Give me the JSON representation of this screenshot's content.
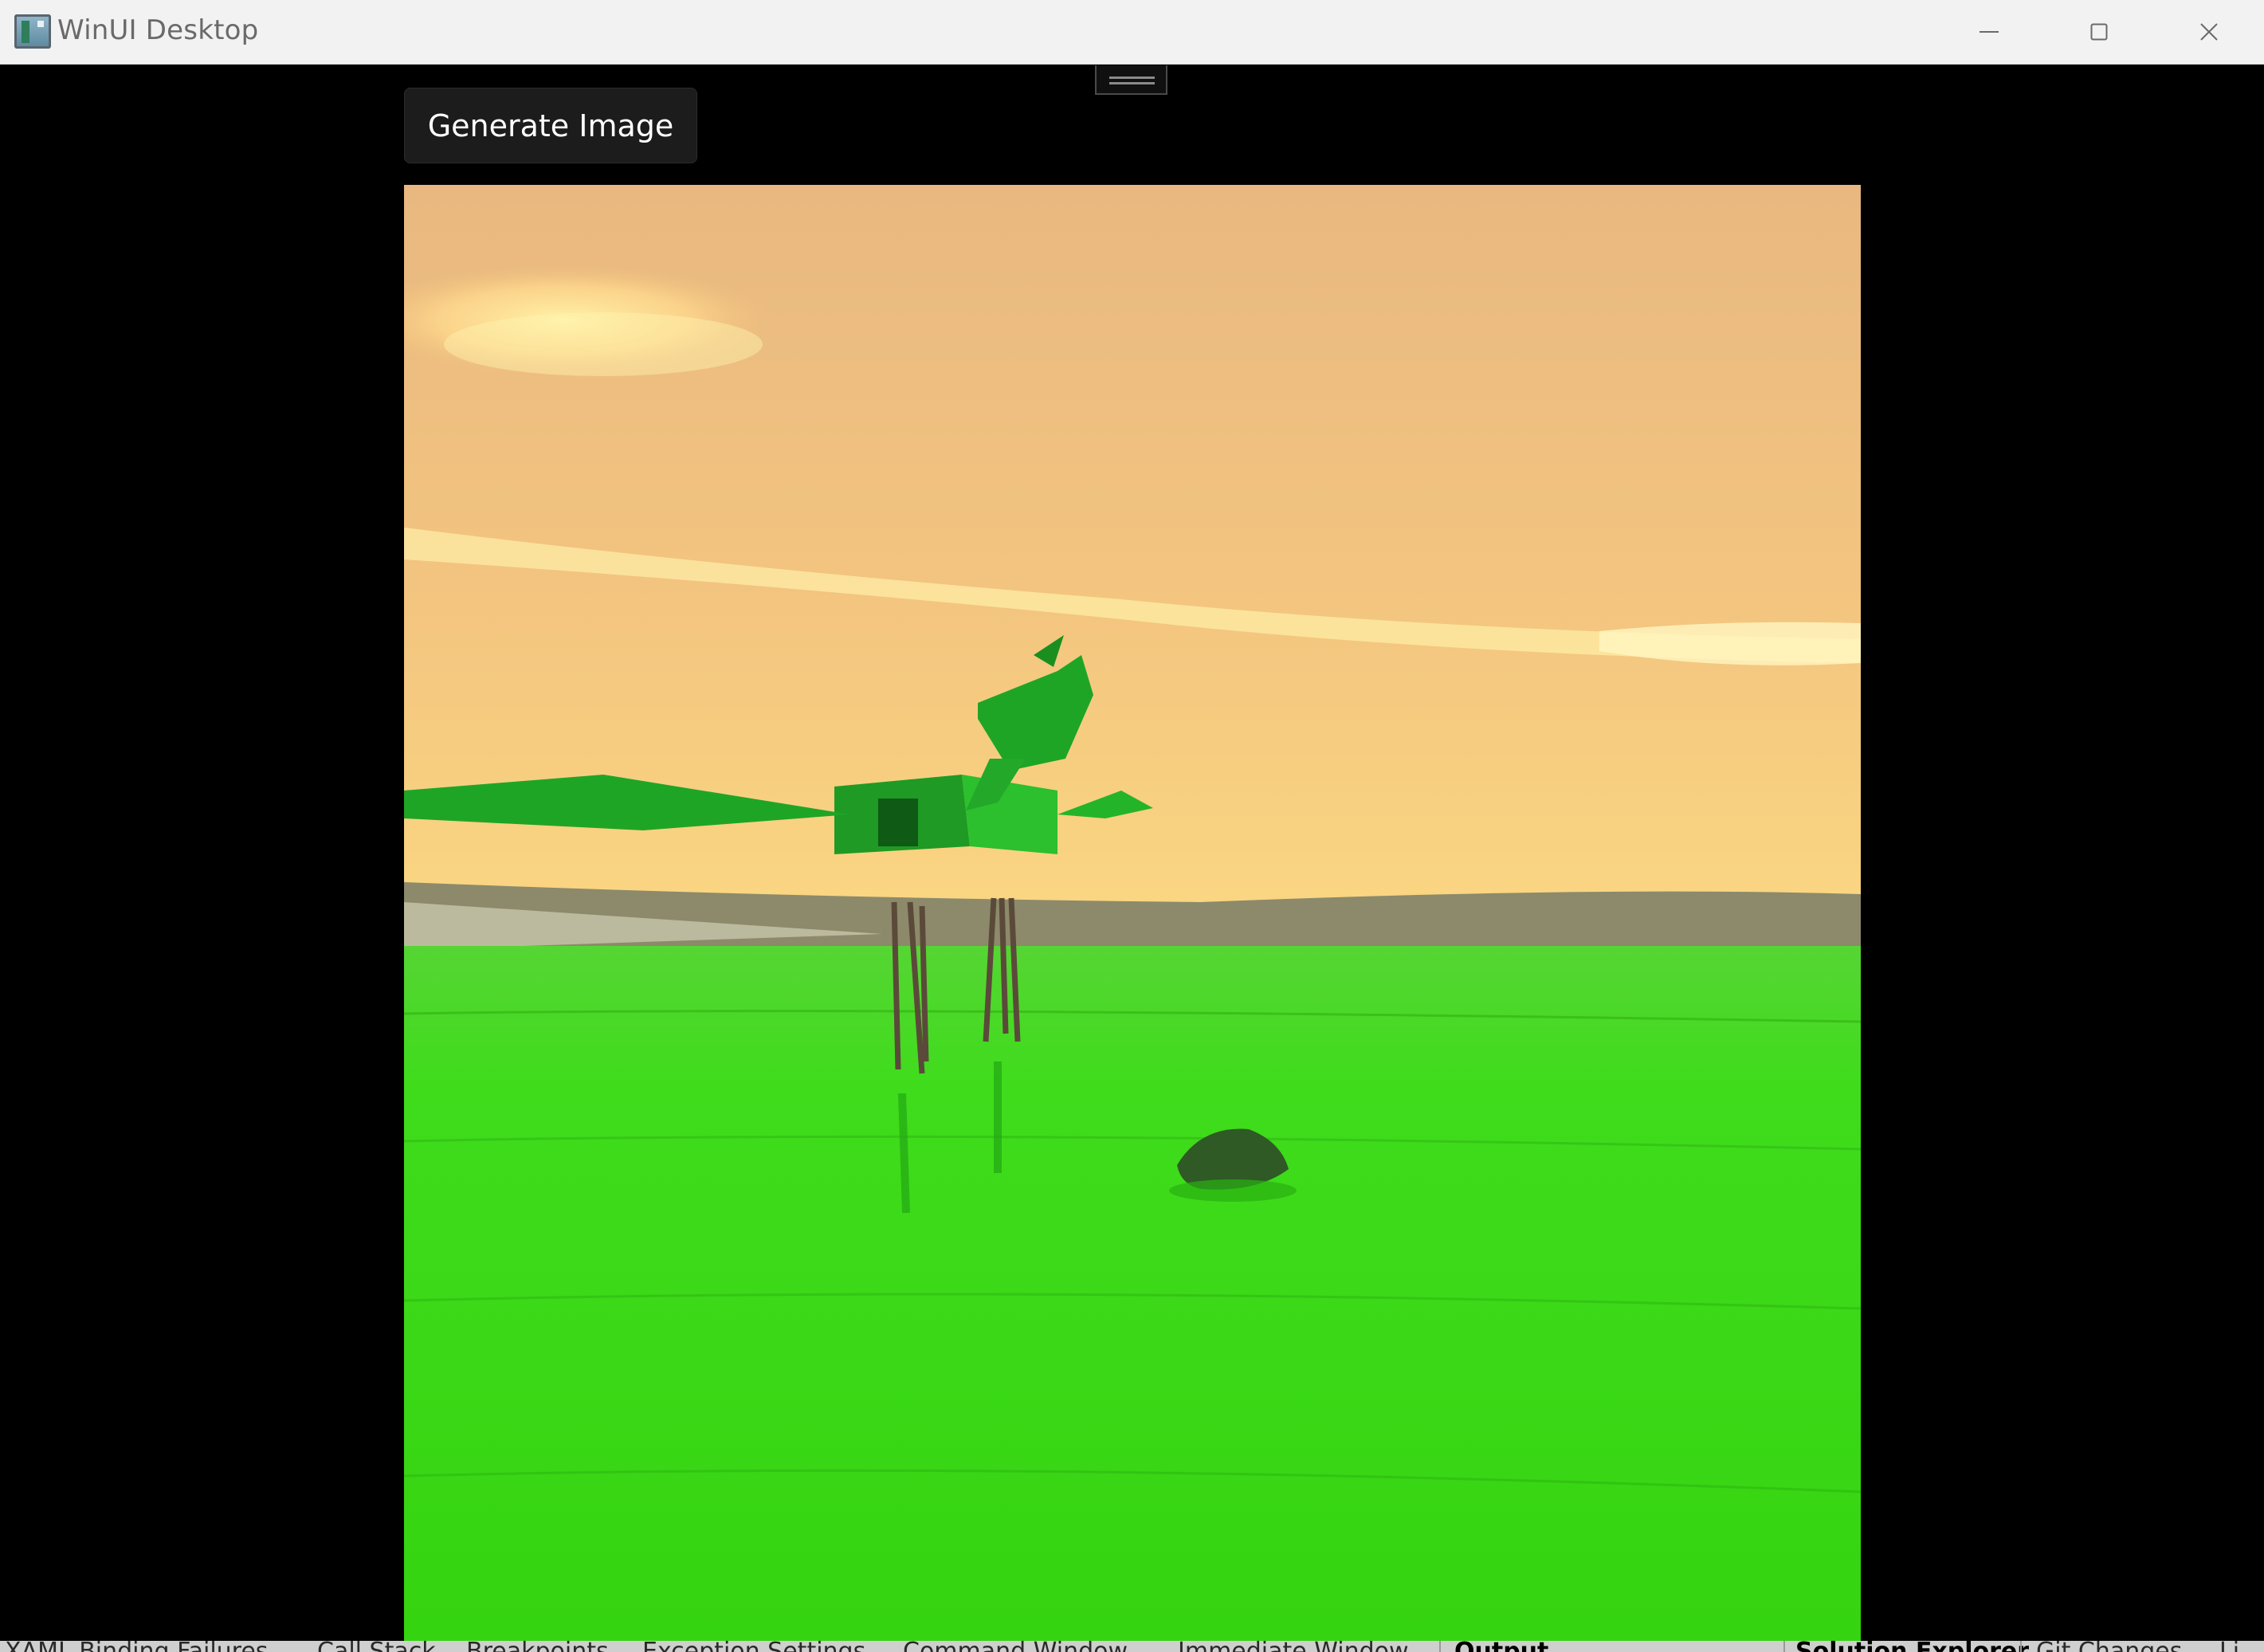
{
  "window": {
    "title": "WinUI Desktop",
    "icon": "app-window-icon",
    "controls": [
      "minimize-icon",
      "maximize-icon",
      "close-icon"
    ]
  },
  "main": {
    "generate_button_label": "Generate Image",
    "image": {
      "alt": "Generated image",
      "colors": {
        "sky_top": "#e8b880",
        "sky_horizon": "#fbd882",
        "water": "#3fdc1c",
        "robot": "#1fa526",
        "background": "#000000"
      }
    }
  },
  "bottom_tabs": {
    "items": [
      {
        "label": "XAML Binding Failures",
        "active": false
      },
      {
        "label": "Call Stack",
        "active": false
      },
      {
        "label": "Breakpoints",
        "active": false
      },
      {
        "label": "Exception Settings",
        "active": false
      },
      {
        "label": "Command Window",
        "active": false
      },
      {
        "label": "Immediate Window",
        "active": false
      },
      {
        "label": "Output",
        "active": true
      },
      {
        "label": "Solution Explorer",
        "active": true
      },
      {
        "label": "Git Changes",
        "active": false
      },
      {
        "label": "Li",
        "active": false
      }
    ]
  }
}
